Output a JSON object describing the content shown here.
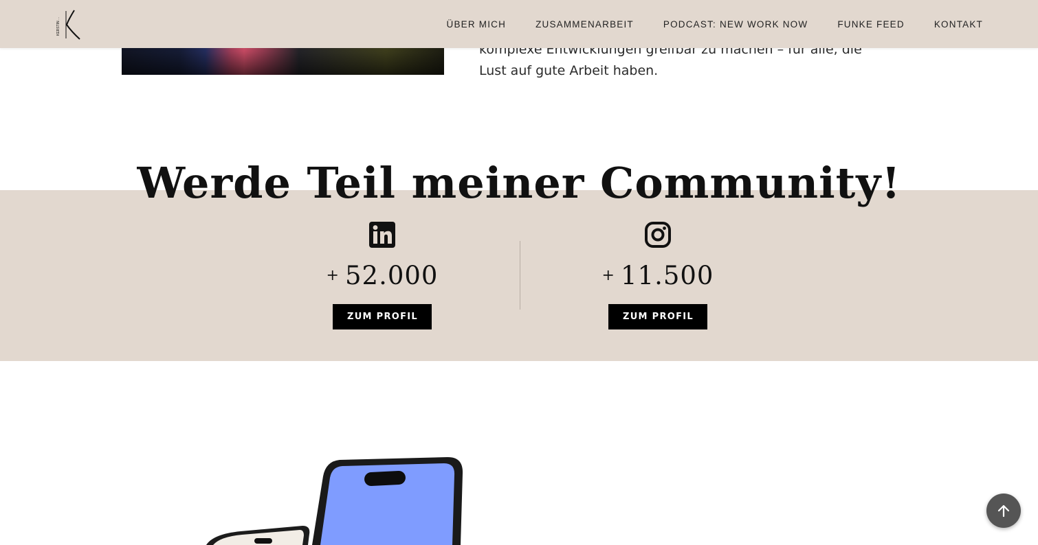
{
  "header": {
    "logo_letter": "K",
    "logo_small_text": "KERSTIN ...",
    "nav": [
      {
        "label": "ÜBER MICH"
      },
      {
        "label": "ZUSAMMENARBEIT"
      },
      {
        "label": "PODCAST: NEW WORK NOW"
      },
      {
        "label": "FUNKE FEED"
      },
      {
        "label": "KONTAKT"
      }
    ]
  },
  "intro": {
    "text": "komplexe Entwicklungen greifbar zu machen – für alle, die Lust auf gute Arbeit haben."
  },
  "community": {
    "title": "Werde Teil meiner Community!",
    "linkedin": {
      "icon": "linkedin-icon",
      "plus": "+",
      "count": "52.000",
      "button": "ZUM PROFIL"
    },
    "instagram": {
      "icon": "instagram-icon",
      "plus": "+",
      "count": "11.500",
      "button": "ZUM PROFIL"
    }
  },
  "scroll_top": {
    "icon": "arrow-up-icon"
  },
  "colors": {
    "band": "#e2d8cf",
    "button": "#000000",
    "phone_screen": "#7f9cff"
  }
}
